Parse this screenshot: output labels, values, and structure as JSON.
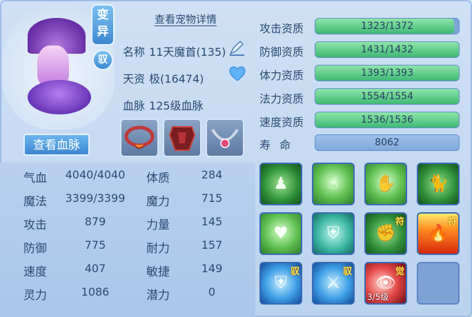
{
  "badges": {
    "variant": "变\n异",
    "ride": "驭"
  },
  "buttons": {
    "view_bloodline": "查看血脉",
    "view_details": "查看宠物详情"
  },
  "info": {
    "name_label": "名称",
    "name_value": "11天魔首(135)",
    "talent_label": "天资",
    "talent_value": "极(16474)",
    "bloodline_label": "血脉",
    "bloodline_value": "125级血脉"
  },
  "aptitudes": [
    {
      "label": "攻击资质",
      "text": "1323/1372",
      "fill": 0.9643
    },
    {
      "label": "防御资质",
      "text": "1431/1432",
      "fill": 0.9993
    },
    {
      "label": "体力资质",
      "text": "1393/1393",
      "fill": 1.0
    },
    {
      "label": "法力资质",
      "text": "1554/1554",
      "fill": 1.0
    },
    {
      "label": "速度资质",
      "text": "1536/1536",
      "fill": 1.0
    }
  ],
  "lifespan": {
    "label": "寿  命",
    "value": "8062"
  },
  "stats": [
    {
      "label": "气血",
      "value": "4040/4040",
      "label2": "体质",
      "value2": "284"
    },
    {
      "label": "魔法",
      "value": "3399/3399",
      "label2": "魔力",
      "value2": "715"
    },
    {
      "label": "攻击",
      "value": "879",
      "label2": "力量",
      "value2": "145"
    },
    {
      "label": "防御",
      "value": "775",
      "label2": "耐力",
      "value2": "157"
    },
    {
      "label": "速度",
      "value": "407",
      "label2": "敏捷",
      "value2": "149"
    },
    {
      "label": "灵力",
      "value": "1086",
      "label2": "潜力",
      "value2": "0"
    }
  ],
  "skills": [
    {
      "icon": "green-figure-icon",
      "tag": "",
      "level": ""
    },
    {
      "icon": "pointing-hand-icon",
      "tag": "",
      "level": ""
    },
    {
      "icon": "praying-hand-icon",
      "tag": "",
      "level": ""
    },
    {
      "icon": "green-cat-icon",
      "tag": "",
      "level": ""
    },
    {
      "icon": "heart-sparkle-icon",
      "tag": "",
      "level": ""
    },
    {
      "icon": "shield-arrow-icon",
      "tag": "",
      "level": ""
    },
    {
      "icon": "muscle-man-icon",
      "tag": "符",
      "level": ""
    },
    {
      "icon": "flame-icon",
      "tag": "符",
      "level": ""
    },
    {
      "icon": "blue-shield-icon",
      "tag": "驭",
      "level": ""
    },
    {
      "icon": "blue-slash-icon",
      "tag": "驭",
      "level": ""
    },
    {
      "icon": "red-eye-icon",
      "tag": "觉",
      "level": "3/5级"
    },
    {
      "icon": "empty-slot",
      "tag": "",
      "level": ""
    }
  ],
  "colors": {
    "bar_fill": "#3fb873",
    "bar_bg": "#7ea6d8",
    "text": "#2b4a72",
    "accent": "#3d86cf"
  }
}
